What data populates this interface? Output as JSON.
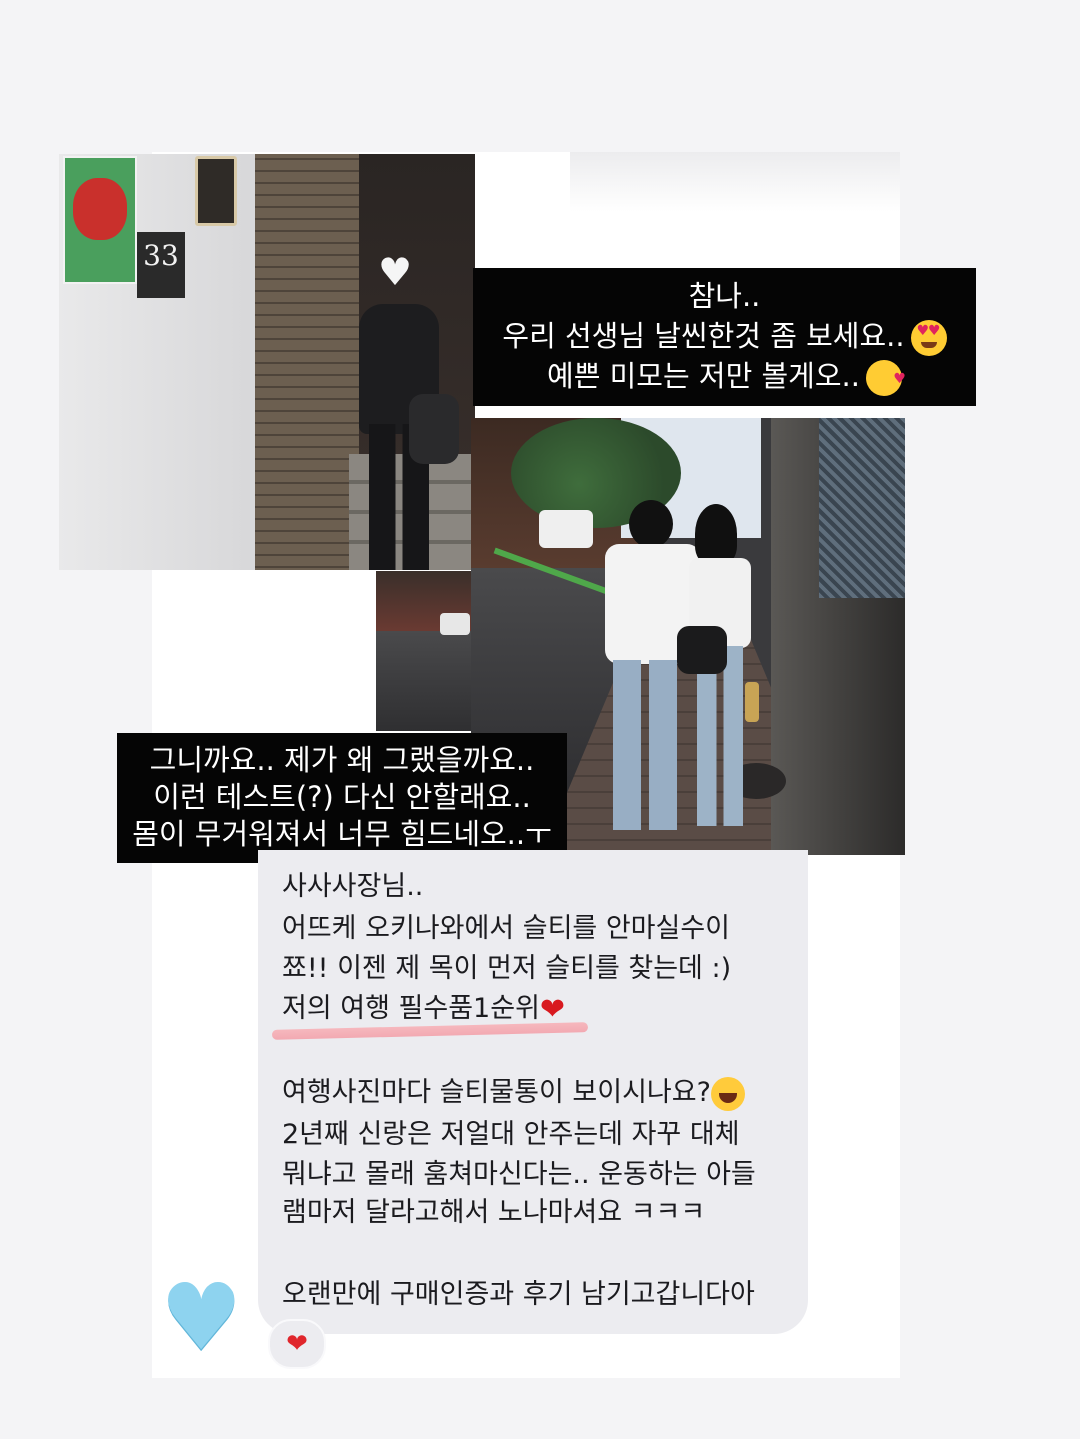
{
  "photos": {
    "building_number": "33",
    "mask_icon": "white-heart-icon"
  },
  "caption_top": {
    "lines": [
      "참나..",
      "우리 선생님 날씬한것 좀 보세요..",
      "예쁜 미모는 저만 볼게오.."
    ],
    "emojis": [
      "heart-eyes-emoji",
      "kissing-face-emoji"
    ]
  },
  "caption_bottom": {
    "lines": [
      "그니까요.. 제가 왜 그랬을까요..",
      "이런 테스트(?) 다신 안할래요..",
      "몸이 무거워져서 너무 힘드네오..ㅜ"
    ]
  },
  "message": {
    "lines": [
      "사사사장님..",
      "어뜨케 오키나와에서 슬티를 안마실수이",
      "쬬!! 이젠 제 목이 먼저 슬티를 찾는데 :)",
      "저의 여행 필수품1순위",
      "",
      "여행사진마다 슬티물통이 보이시나요?",
      "2년째 신랑은 저얼대 안주는데 자꾸 대체",
      "뭐냐고 몰래 훔쳐마신다는.. 운동하는 아들",
      "램마저 달라고해서 노나마셔요 ㅋㅋㅋ",
      "",
      "오랜만에 구매인증과 후기 남기고갑니다아"
    ],
    "heart": "❤",
    "reaction": "❤",
    "blue_heart": "💙"
  },
  "colors": {
    "caption_bg": "#050505",
    "bubble_bg": "#ececf0",
    "underline": "#f3a2ab",
    "blue_heart": "#8ed3ef"
  }
}
